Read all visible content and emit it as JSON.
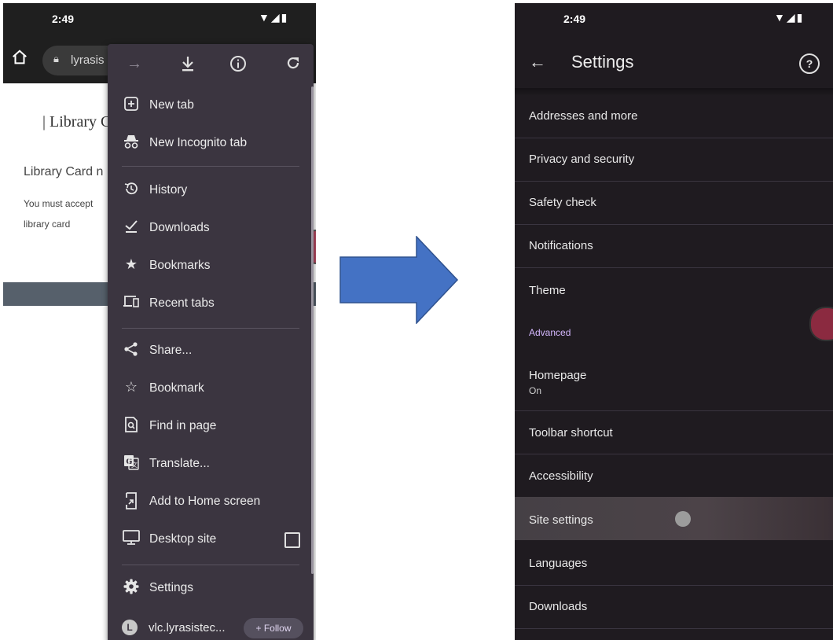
{
  "left": {
    "status": {
      "time": "2:49",
      "icons": "▼◢▮"
    },
    "urlbar": {
      "url": "lyrasis"
    },
    "page": {
      "title": "| Library C",
      "subtitle": "Library Card n",
      "body_line1": "You must accept",
      "body_line2": "library card"
    },
    "menu": {
      "toolbar": [
        "forward-icon",
        "download-icon",
        "info-icon",
        "reload-icon"
      ],
      "items": {
        "new_tab": "New tab",
        "new_incognito_tab": "New Incognito tab",
        "history": "History",
        "downloads": "Downloads",
        "bookmarks": "Bookmarks",
        "recent_tabs": "Recent tabs",
        "share": "Share...",
        "bookmark": "Bookmark",
        "find_in_page": "Find in page",
        "translate": "Translate...",
        "add_to_home": "Add to Home screen",
        "desktop_site": "Desktop site",
        "settings": "Settings"
      },
      "footer": {
        "avatar_letter": "L",
        "account": "vlc.lyrasistec...",
        "follow": "+ Follow"
      }
    }
  },
  "arrow_color": "#4472c4",
  "right": {
    "status": {
      "time": "2:49",
      "icons": "▼◢▮"
    },
    "header": {
      "title": "Settings",
      "help": "?"
    },
    "rows": {
      "addresses": "Addresses and more",
      "privacy": "Privacy and security",
      "safety_check": "Safety check",
      "notifications": "Notifications",
      "theme": "Theme",
      "advanced": "Advanced",
      "homepage": "Homepage",
      "homepage_value": "On",
      "toolbar_shortcut": "Toolbar shortcut",
      "accessibility": "Accessibility",
      "site_settings": "Site settings",
      "languages": "Languages",
      "downloads": "Downloads"
    }
  }
}
